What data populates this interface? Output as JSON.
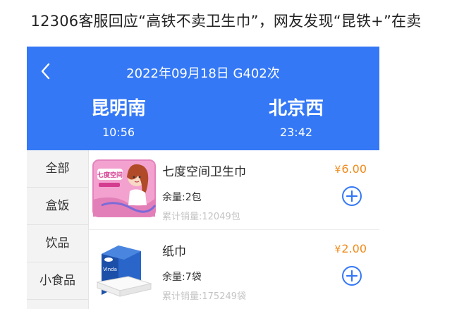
{
  "headline": "12306客服回应“高铁不卖卫生巾”，网友发现“昆铁+”在卖",
  "header": {
    "trip_title": "2022年09月18日 G402次",
    "from_station": "昆明南",
    "to_station": "北京西",
    "depart_time": "10:56",
    "arrive_time": "23:42",
    "background_color": "#3478f6"
  },
  "sidebar": {
    "items": [
      {
        "label": "全部"
      },
      {
        "label": "盒饭"
      },
      {
        "label": "饮品"
      },
      {
        "label": "小食品"
      }
    ]
  },
  "products": [
    {
      "name": "七度空间卫生巾",
      "currency": "¥",
      "price": "6.00",
      "stock": "余量:2包",
      "sold": "累计销量:12049包",
      "image_icon": "sanitary-pad-package-icon",
      "image_text": "七度空间"
    },
    {
      "name": "纸巾",
      "currency": "¥",
      "price": "2.00",
      "stock": "余量:7袋",
      "sold": "累计销量:175249袋",
      "image_icon": "tissue-pack-icon",
      "image_text": "Vinda"
    }
  ],
  "colors": {
    "accent_blue": "#3478f6",
    "price_orange": "#f08a1a",
    "add_button_blue": "#3478f6"
  }
}
